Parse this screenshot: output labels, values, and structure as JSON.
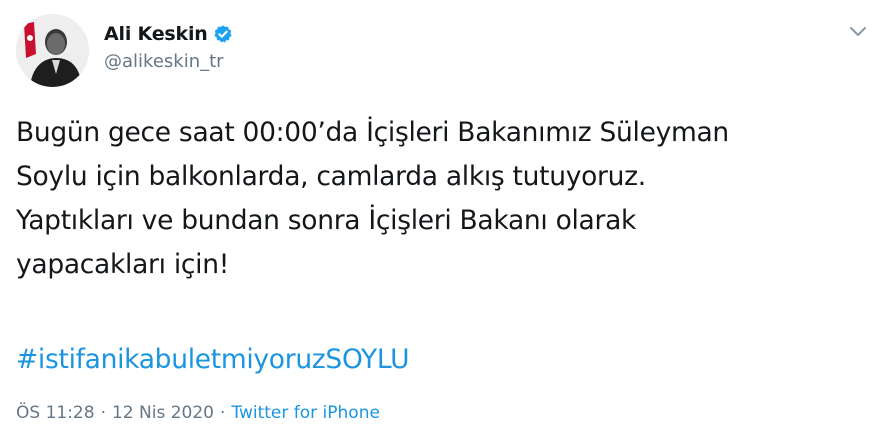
{
  "tweet": {
    "author": {
      "display_name": "Ali Keskin",
      "handle": "@alikeskin_tr",
      "verified": true,
      "avatar_icon": "profile-photo"
    },
    "text": "Bugün gece saat 00:00’da İçişleri Bakanımız Süleyman\nSoylu için balkonlarda, camlarda alkış tutuyoruz.\nYaptıkları ve bundan sonra İçişleri Bakanı olarak\nyapacakları için!",
    "hashtag": "#istifanikabuletmiyoruzSOYLU",
    "time": "ÖS 11:28",
    "separator": "·",
    "date": "12 Nis 2020",
    "source": "Twitter for iPhone",
    "menu_icon": "chevron-down-icon"
  },
  "colors": {
    "link": "#1b95e0",
    "secondary_text": "#657786",
    "primary_text": "#14171a",
    "verified_badge": "#1da1f2"
  }
}
